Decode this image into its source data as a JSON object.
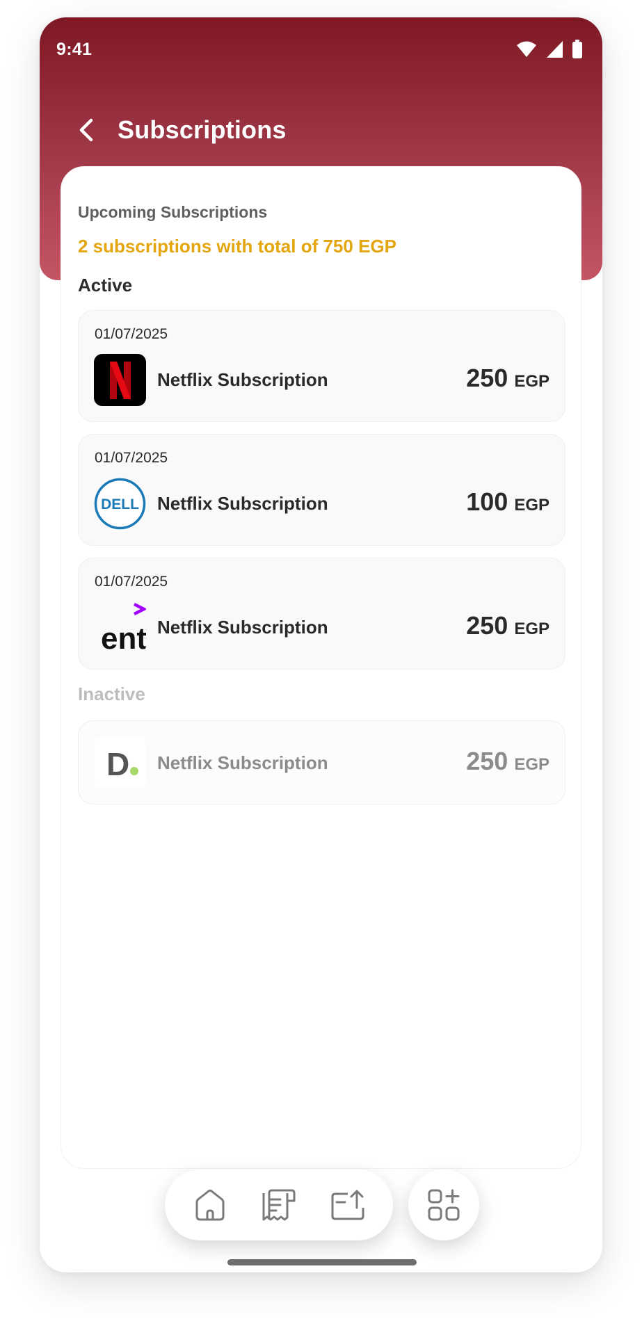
{
  "status_bar": {
    "time": "9:41"
  },
  "header": {
    "title": "Subscriptions"
  },
  "upcoming": {
    "label": "Upcoming Subscriptions",
    "summary": "2 subscriptions with total of 750 EGP"
  },
  "sections": {
    "active_label": "Active",
    "inactive_label": "Inactive"
  },
  "active_items": [
    {
      "date": "01/07/2025",
      "name": "Netflix Subscription",
      "amount": "250",
      "currency": "EGP",
      "logo": "netflix-logo"
    },
    {
      "date": "01/07/2025",
      "name": "Netflix Subscription",
      "amount": "100",
      "currency": "EGP",
      "logo": "dell-logo",
      "logo_text": "DELL"
    },
    {
      "date": "01/07/2025",
      "name": "Netflix Subscription",
      "amount": "250",
      "currency": "EGP",
      "logo": "accenture-logo",
      "logo_text": "ent"
    }
  ],
  "inactive_items": [
    {
      "name": "Netflix Subscription",
      "amount": "250",
      "currency": "EGP",
      "logo": "deliveroo-d-logo",
      "logo_text": "D"
    }
  ],
  "nav": {
    "items": [
      "home-icon",
      "receipt-icon",
      "transfer-icon"
    ],
    "fab_icon": "apps-add-icon"
  },
  "colors": {
    "header_top": "#7e1824",
    "header_bottom": "#c45565",
    "accent_gold": "#e3a60e",
    "netflix_red": "#e50914",
    "dell_blue": "#1a7ab8",
    "accenture_purple": "#a100ff"
  }
}
